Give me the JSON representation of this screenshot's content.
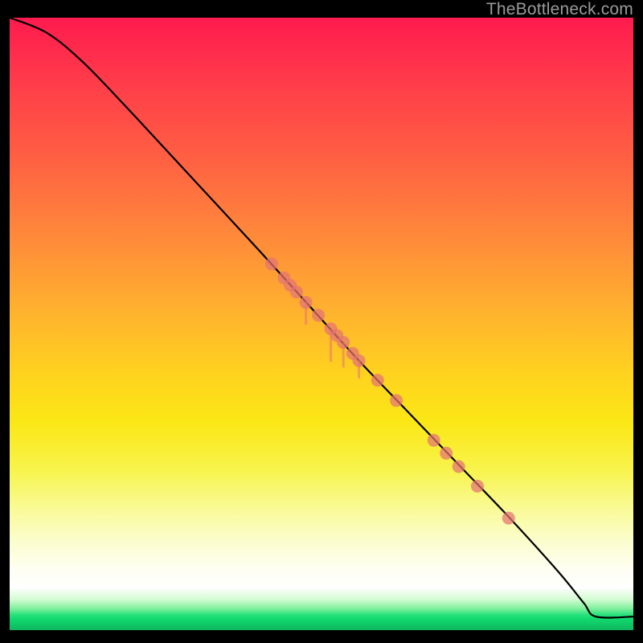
{
  "attribution": "TheBottleneck.com",
  "colors": {
    "curve": "#000000",
    "dot": "#e57373",
    "stem": "#e57373"
  },
  "chart_data": {
    "type": "line",
    "title": "",
    "xlabel": "",
    "ylabel": "",
    "xlim": [
      0,
      100
    ],
    "ylim": [
      0,
      100
    ],
    "curve": [
      {
        "x": 0,
        "y": 100
      },
      {
        "x": 6,
        "y": 97.5
      },
      {
        "x": 12,
        "y": 92.5
      },
      {
        "x": 20,
        "y": 84
      },
      {
        "x": 30,
        "y": 73
      },
      {
        "x": 40,
        "y": 62
      },
      {
        "x": 48,
        "y": 53
      },
      {
        "x": 56,
        "y": 44
      },
      {
        "x": 64,
        "y": 35.5
      },
      {
        "x": 72,
        "y": 27
      },
      {
        "x": 80,
        "y": 18.5
      },
      {
        "x": 88,
        "y": 9.5
      },
      {
        "x": 92,
        "y": 4.5
      },
      {
        "x": 94,
        "y": 2.2
      },
      {
        "x": 100,
        "y": 2.2
      }
    ],
    "highlight_points": [
      {
        "x": 42,
        "y": 59.8
      },
      {
        "x": 44,
        "y": 57.5
      },
      {
        "x": 45,
        "y": 56.3
      },
      {
        "x": 46,
        "y": 55.2
      },
      {
        "x": 47.5,
        "y": 53.5
      },
      {
        "x": 49.5,
        "y": 51.4
      },
      {
        "x": 51.5,
        "y": 49.2
      },
      {
        "x": 52.5,
        "y": 48.1
      },
      {
        "x": 53.5,
        "y": 47
      },
      {
        "x": 55,
        "y": 45.2
      },
      {
        "x": 56,
        "y": 44
      },
      {
        "x": 59,
        "y": 40.8
      },
      {
        "x": 62,
        "y": 37.5
      },
      {
        "x": 68,
        "y": 31
      },
      {
        "x": 70,
        "y": 28.9
      },
      {
        "x": 72,
        "y": 26.7
      },
      {
        "x": 75,
        "y": 23.5
      },
      {
        "x": 80,
        "y": 18.3
      }
    ],
    "annotations": [
      {
        "x": 47.5,
        "len": 28
      },
      {
        "x": 51.5,
        "len": 40
      },
      {
        "x": 53.5,
        "len": 30
      },
      {
        "x": 56.0,
        "len": 22
      }
    ]
  }
}
